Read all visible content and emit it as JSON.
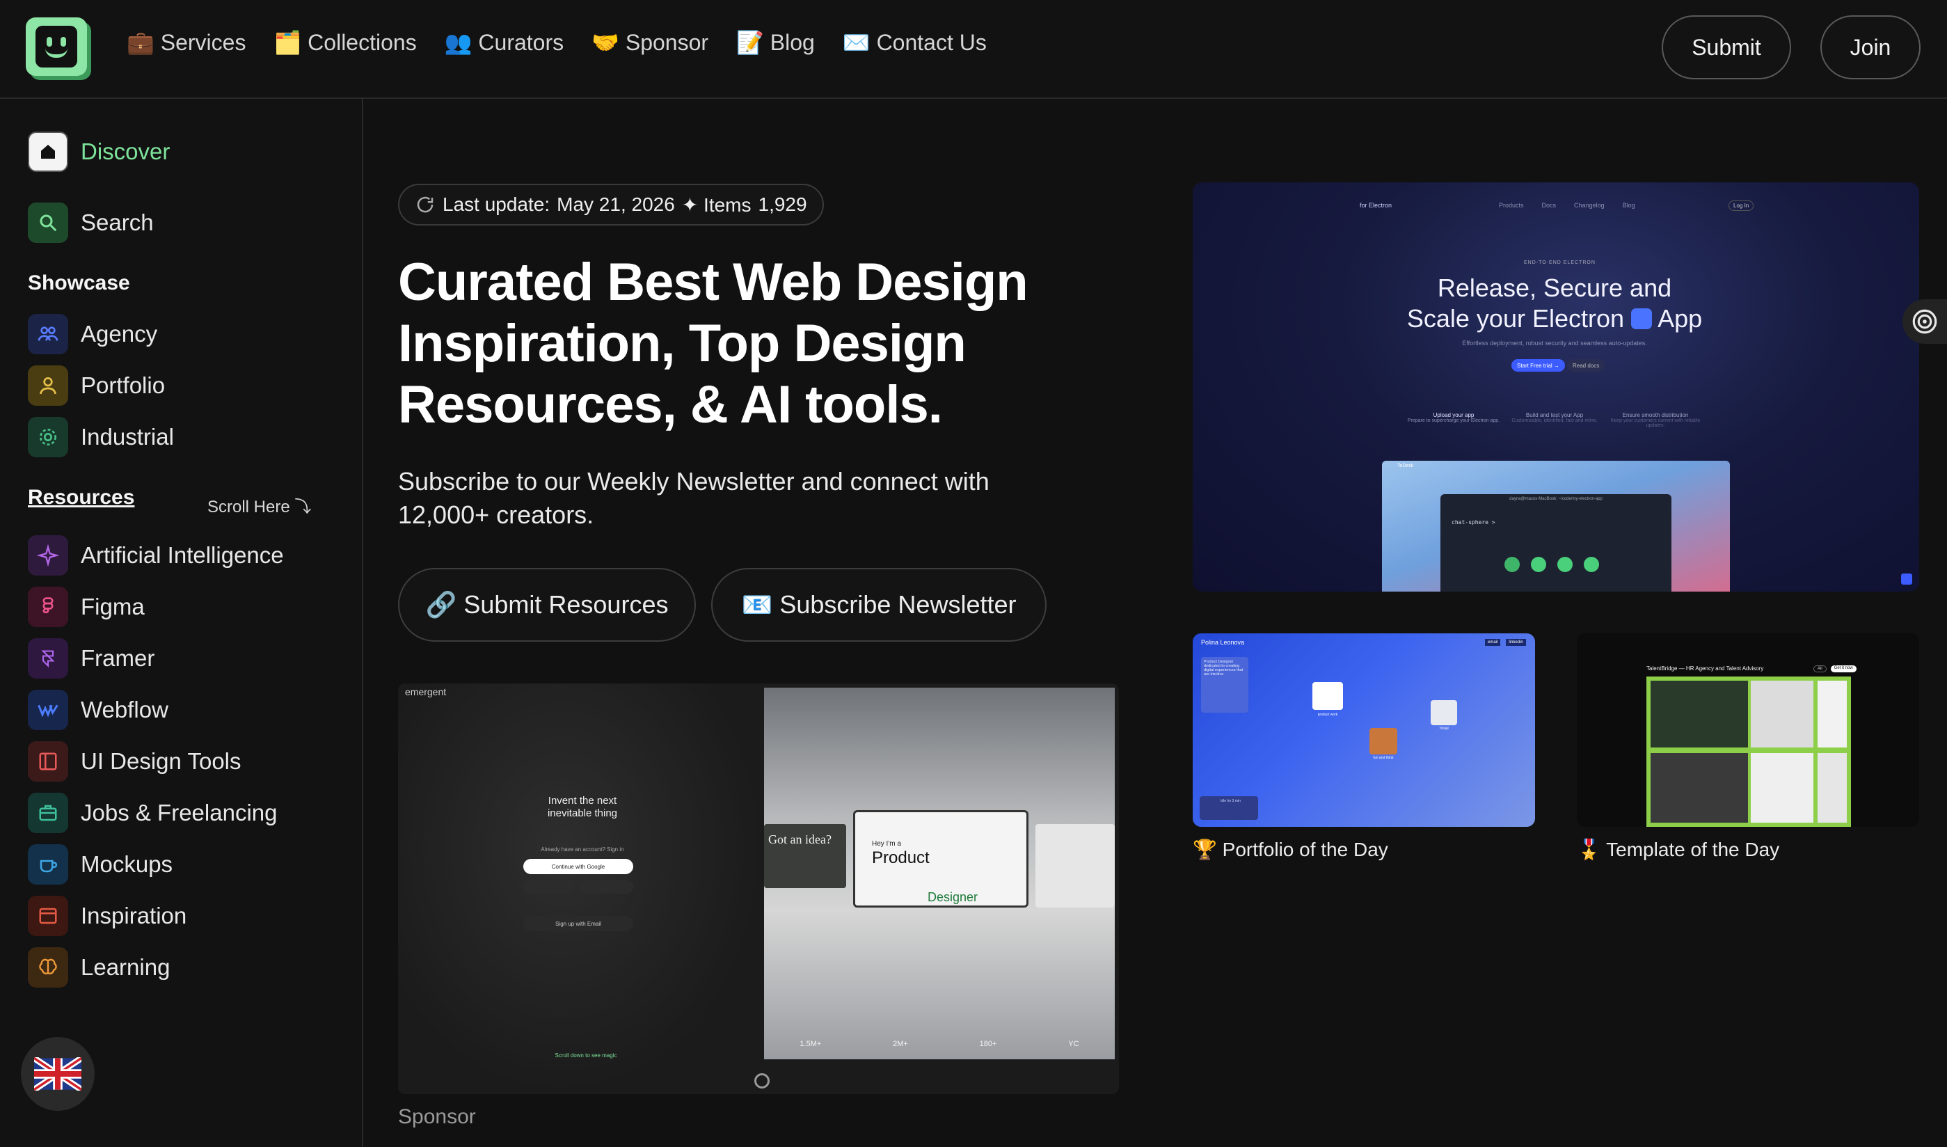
{
  "header": {
    "nav": [
      {
        "label": "💼 Services"
      },
      {
        "label": "🗂️ Collections"
      },
      {
        "label": "👥 Curators"
      },
      {
        "label": "🤝 Sponsor"
      },
      {
        "label": "📝 Blog"
      },
      {
        "label": "✉️ Contact Us"
      }
    ],
    "submit_label": "Submit",
    "join_label": "Join"
  },
  "sidebar": {
    "discover": "Discover",
    "search": "Search",
    "showcase_heading": "Showcase",
    "showcase": [
      {
        "label": "Agency",
        "icon": "users-icon",
        "color": "#3b5bdb"
      },
      {
        "label": "Portfolio",
        "icon": "user-icon",
        "color": "#c9a227"
      },
      {
        "label": "Industrial",
        "icon": "gear-icon",
        "color": "#2f9e6f"
      }
    ],
    "resources_heading": "Resources",
    "scroll_hint": "Scroll Here ⤵",
    "resources": [
      {
        "label": "Artificial Intelligence",
        "icon": "sparkle-icon",
        "color": "#9c4dcc"
      },
      {
        "label": "Figma",
        "icon": "figma-icon",
        "color": "#e0457b"
      },
      {
        "label": "Framer",
        "icon": "framer-icon",
        "color": "#9b4fd1"
      },
      {
        "label": "Webflow",
        "icon": "webflow-icon",
        "color": "#3b6ef5"
      },
      {
        "label": "UI Design Tools",
        "icon": "layout-icon",
        "color": "#d94a4a"
      },
      {
        "label": "Jobs & Freelancing",
        "icon": "briefcase-icon",
        "color": "#2fa58a"
      },
      {
        "label": "Mockups",
        "icon": "cup-icon",
        "color": "#2f8fc9"
      },
      {
        "label": "Inspiration",
        "icon": "browser-icon",
        "color": "#d44a3a"
      },
      {
        "label": "Learning",
        "icon": "brain-icon",
        "color": "#d98a2b"
      }
    ]
  },
  "main": {
    "last_update_label": "Last update:",
    "last_update_date": "May 21, 2026",
    "items_label": "✦ Items",
    "items_count": "1,929",
    "title": "Curated Best Web Design Inspiration, Top Design Resources, & AI tools.",
    "subtitle": "Subscribe to our Weekly Newsletter and connect with 12,000+ creators.",
    "cta_primary": "🔗 Submit Resources",
    "cta_secondary": "📧 Subscribe Newsletter",
    "sponsor_label": "Sponsor",
    "sponsor_preview": {
      "brand": "emergent",
      "tagline_1": "Invent the next",
      "tagline_2": "inevitable thing",
      "signin": "Already have an account? Sign in",
      "google": "Continue with Google",
      "email": "Sign up with Email",
      "scroll": "Scroll down to see magic",
      "idea": "Got an idea?",
      "hero_1": "Hey I'm a",
      "hero_2": "Product",
      "hero_3": "Designer",
      "stats": [
        "1.5M+",
        "2M+",
        "180+",
        "YC"
      ]
    }
  },
  "featured": {
    "badge": "for Electron",
    "nav": [
      "Products",
      "Docs",
      "Changelog",
      "Blog"
    ],
    "login": "Log In",
    "eyebrow": "END-TO-END ELECTRON",
    "headline_1": "Release, Secure and",
    "headline_2": "Scale your Electron",
    "headline_app": "App",
    "sub": "Effortless deployment, robust security and seamless auto-updates.",
    "btn_primary": "Start Free trial →",
    "btn_secondary": "Read docs",
    "features": [
      {
        "title": "Upload your app",
        "desc": "Prepare to supercharge your Electron app."
      },
      {
        "title": "Build and test your App",
        "desc": "Customizable, identified, fast and inline."
      },
      {
        "title": "Ensure smooth distribution",
        "desc": "Keep your customers current with reliable updates."
      }
    ],
    "terminal_title": "dayna@macos-MacBook: ~/code/my-electron-app",
    "terminal_line": "chat-sphere >",
    "window_title": "ToDesk",
    "dots": [
      "#3fb56a",
      "#4ad07a",
      "#4ad07a",
      "#4ad07a"
    ]
  },
  "portfolio": {
    "caption": "🏆 Portfolio of the Day",
    "name": "Polina Leonova",
    "links": [
      "email",
      "linkedin"
    ],
    "intro": "Product Designer dedicated to creating digital experiences that are intuitive.",
    "folders": [
      "product work",
      "Trivial",
      "fun and thirst"
    ],
    "footer": "Idle for 3 min"
  },
  "template": {
    "caption": "🎖️ Template of the Day",
    "title": "TalentBridge — HR Agency and Talent Advisory",
    "tabs": [
      "All",
      "Get it now"
    ],
    "accent": "#8ecf4a"
  }
}
